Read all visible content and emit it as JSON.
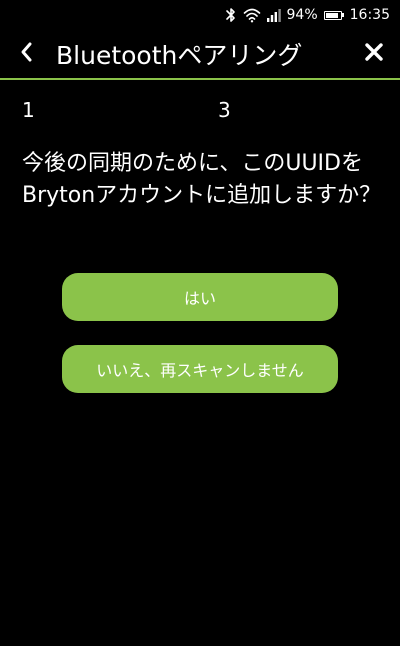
{
  "status_bar": {
    "battery": "94%",
    "time": "16:35",
    "battery_level": 0.94,
    "icons": [
      "bluetooth-icon",
      "wifi-icon",
      "signal-icon",
      "battery-icon"
    ]
  },
  "header": {
    "title": "Bluetoothペアリング",
    "back_icon": "chevron-left-icon",
    "close_icon": "close-icon"
  },
  "devices": {
    "first": "1",
    "second": "3"
  },
  "message": {
    "text": "今後の同期のために、このUUIDをBrytonアカウントに追加しますか？"
  },
  "buttons": {
    "yes_label": "はい",
    "no_label": "いいえ、再スキャンしません"
  },
  "colors": {
    "accent": "#8bc34a",
    "background": "#000000",
    "text": "#ffffff"
  }
}
